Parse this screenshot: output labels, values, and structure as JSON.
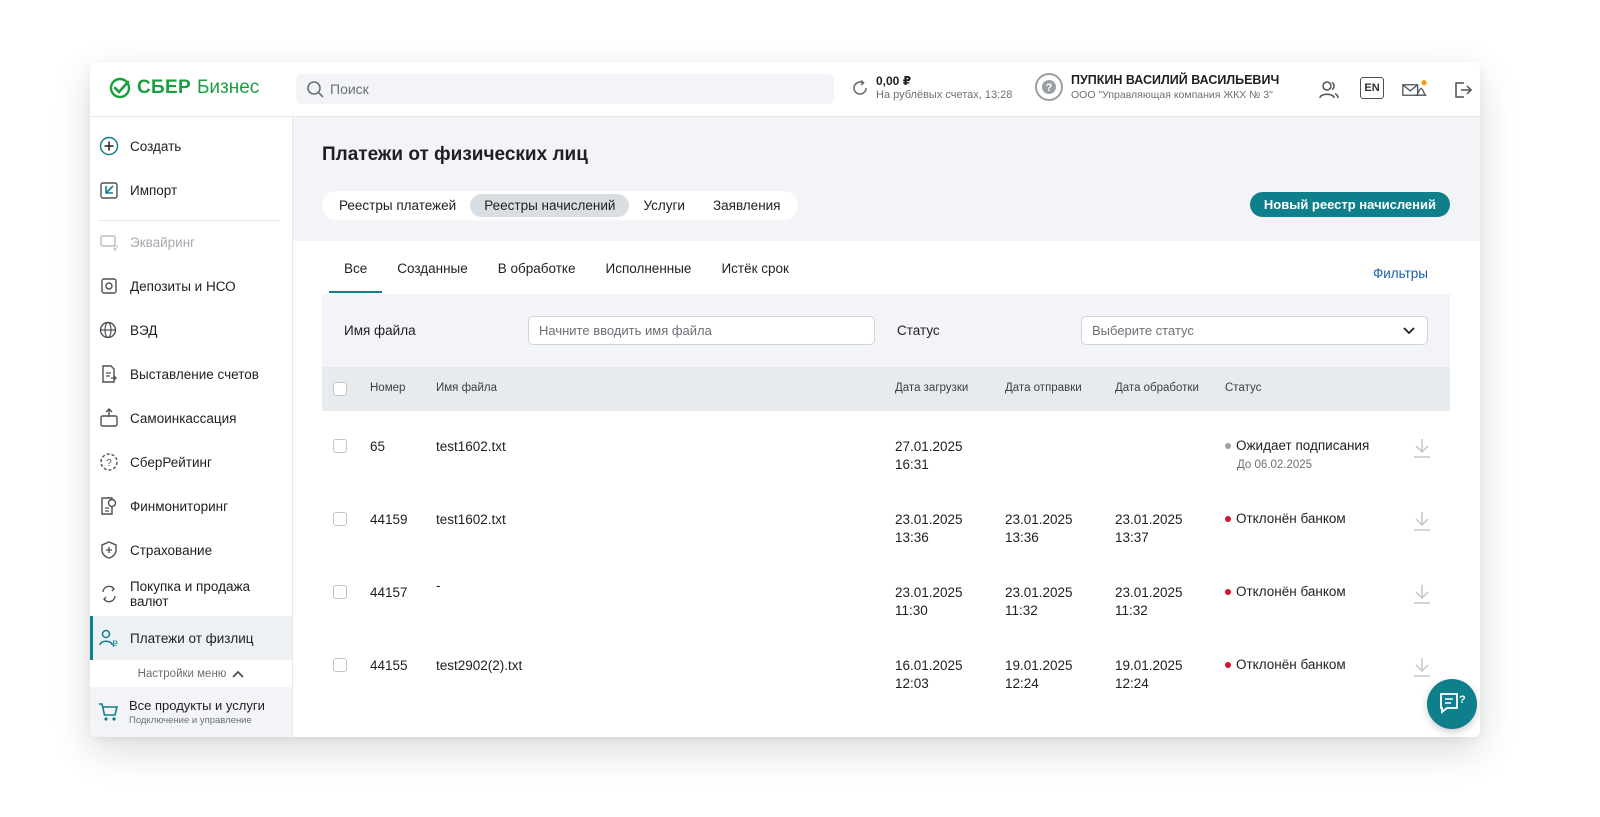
{
  "header": {
    "brand_bold": "СБЕР",
    "brand_light": "Бизнес",
    "search_placeholder": "Поиск",
    "balance_amount": "0,00 ₽",
    "balance_sub": "На рублёвых счетах, 13:28",
    "user_name": "ПУПКИН ВАСИЛИЙ ВАСИЛЬЕВИЧ",
    "user_org": "ООО \"Управляющая компания ЖКХ № 3\"",
    "lang": "EN"
  },
  "sidebar": {
    "items": [
      {
        "label": "Создать",
        "icon": "plus-circle-icon",
        "state": "normal"
      },
      {
        "label": "Импорт",
        "icon": "import-icon",
        "state": "normal"
      },
      {
        "label": "Эквайринг",
        "icon": "acquiring-icon",
        "state": "disabled"
      },
      {
        "label": "Депозиты и НСО",
        "icon": "deposit-icon",
        "state": "normal"
      },
      {
        "label": "ВЭД",
        "icon": "globe-icon",
        "state": "normal"
      },
      {
        "label": "Выставление счетов",
        "icon": "invoice-icon",
        "state": "normal"
      },
      {
        "label": "Самоинкассация",
        "icon": "cash-deposit-icon",
        "state": "normal"
      },
      {
        "label": "СберРейтинг",
        "icon": "rating-icon",
        "state": "normal"
      },
      {
        "label": "Финмониторинг",
        "icon": "finmonitoring-icon",
        "state": "normal"
      },
      {
        "label": "Страхование",
        "icon": "shield-icon",
        "state": "normal"
      },
      {
        "label": "Покупка и продажа валют",
        "icon": "currency-exchange-icon",
        "state": "normal"
      },
      {
        "label": "Платежи от физлиц",
        "icon": "payments-people-icon",
        "state": "active"
      }
    ],
    "menu_settings": "Настройки меню",
    "all_products_title": "Все продукты и услуги",
    "all_products_sub": "Подключение и управление"
  },
  "main": {
    "title": "Платежи от физических лиц",
    "segments": [
      {
        "label": "Реестры платежей",
        "selected": false
      },
      {
        "label": "Реестры начислений",
        "selected": true
      },
      {
        "label": "Услуги",
        "selected": false
      },
      {
        "label": "Заявления",
        "selected": false
      }
    ],
    "new_button": "Новый реестр начислений",
    "tabs": [
      {
        "label": "Все",
        "selected": true
      },
      {
        "label": "Созданные",
        "selected": false
      },
      {
        "label": "В обработке",
        "selected": false
      },
      {
        "label": "Исполненные",
        "selected": false
      },
      {
        "label": "Истёк срок",
        "selected": false
      }
    ],
    "filters_link": "Фильтры",
    "filter": {
      "file_label": "Имя файла",
      "file_placeholder": "Начните вводить имя файла",
      "status_label": "Статус",
      "status_placeholder": "Выберите статус"
    },
    "table": {
      "columns": [
        "Номер",
        "Имя файла",
        "Дата загрузки",
        "Дата отправки",
        "Дата обработки",
        "Статус"
      ],
      "rows": [
        {
          "number": "65",
          "file": "test1602.txt",
          "upload_date": "27.01.2025",
          "upload_time": "16:31",
          "send_date": "",
          "send_time": "",
          "proc_date": "",
          "proc_time": "",
          "status": "Ожидает подписания",
          "status_color": "#9aa3ab",
          "status_sub": "До 06.02.2025"
        },
        {
          "number": "44159",
          "file": "test1602.txt",
          "upload_date": "23.01.2025",
          "upload_time": "13:36",
          "send_date": "23.01.2025",
          "send_time": "13:36",
          "proc_date": "23.01.2025",
          "proc_time": "13:37",
          "status": "Отклонён банком",
          "status_color": "#d0142c",
          "status_sub": ""
        },
        {
          "number": "44157",
          "file": "-",
          "upload_date": "23.01.2025",
          "upload_time": "11:30",
          "send_date": "23.01.2025",
          "send_time": "11:32",
          "proc_date": "23.01.2025",
          "proc_time": "11:32",
          "status": "Отклонён банком",
          "status_color": "#d0142c",
          "status_sub": ""
        },
        {
          "number": "44155",
          "file": "test2902(2).txt",
          "upload_date": "16.01.2025",
          "upload_time": "12:03",
          "send_date": "19.01.2025",
          "send_time": "12:24",
          "proc_date": "19.01.2025",
          "proc_time": "12:24",
          "status": "Отклонён банком",
          "status_color": "#d0142c",
          "status_sub": ""
        }
      ]
    }
  },
  "colors": {
    "brand_green": "#1a9f3e",
    "accent_teal": "#107f8c",
    "link_blue": "#1b5fa8",
    "error_red": "#d0142c",
    "notify_orange": "#f39c12"
  }
}
